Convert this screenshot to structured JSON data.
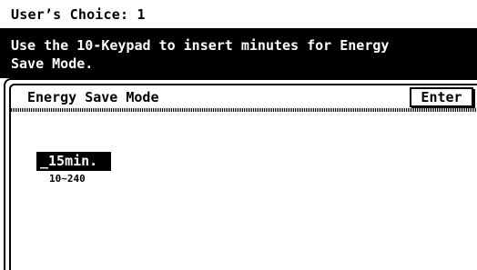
{
  "header": {
    "title": "User’s Choice: 1"
  },
  "message": {
    "text": "Use the 10-Keypad to insert minutes for Energy\nSave Mode."
  },
  "panel": {
    "title": "Energy Save Mode",
    "enter_label": "Enter"
  },
  "setting": {
    "value_display": "_15min.",
    "range": "10~240"
  }
}
